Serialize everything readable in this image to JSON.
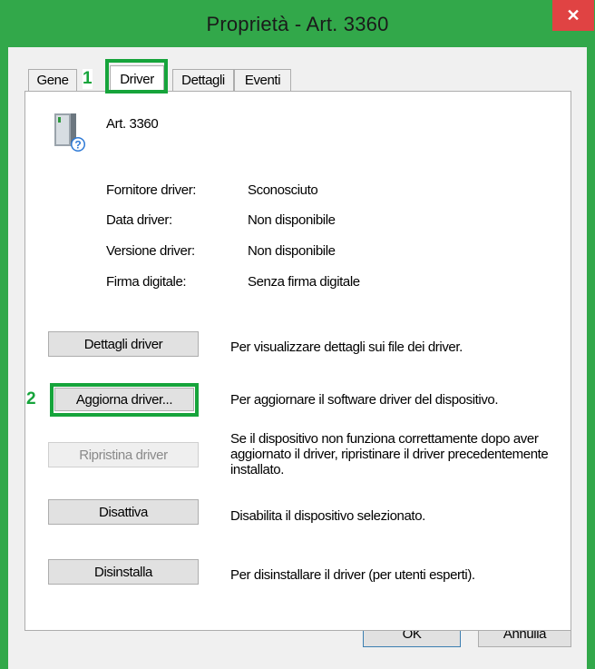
{
  "window": {
    "title": "Proprietà - Art. 3360",
    "close_glyph": "✕"
  },
  "tabs": [
    {
      "label": "Gene"
    },
    {
      "label": "Driver"
    },
    {
      "label": "Dettagli"
    },
    {
      "label": "Eventi"
    }
  ],
  "callouts": [
    {
      "number": "1"
    },
    {
      "number": "2"
    }
  ],
  "device": {
    "name": "Art. 3360",
    "icon": "device-unknown-icon"
  },
  "properties": [
    {
      "label": "Fornitore driver:",
      "value": "Sconosciuto"
    },
    {
      "label": "Data driver:",
      "value": "Non disponibile"
    },
    {
      "label": "Versione driver:",
      "value": "Non disponibile"
    },
    {
      "label": "Firma digitale:",
      "value": "Senza firma digitale"
    }
  ],
  "actions": [
    {
      "button": "Dettagli driver",
      "description": "Per visualizzare dettagli sui file dei driver."
    },
    {
      "button": "Aggiorna driver...",
      "description": "Per aggiornare il software driver del dispositivo."
    },
    {
      "button": "Ripristina driver",
      "description": "Se il dispositivo non funziona correttamente dopo aver aggiornato il driver, ripristinare il driver precedentemente installato."
    },
    {
      "button": "Disattiva",
      "description": "Disabilita il dispositivo selezionato."
    },
    {
      "button": "Disinstalla",
      "description": "Per disinstallare il driver (per utenti esperti)."
    }
  ],
  "footer": {
    "ok": "OK",
    "cancel": "Annulla"
  },
  "colors": {
    "frame": "#32a84a",
    "highlight": "#16a43b",
    "close": "#e04343"
  }
}
